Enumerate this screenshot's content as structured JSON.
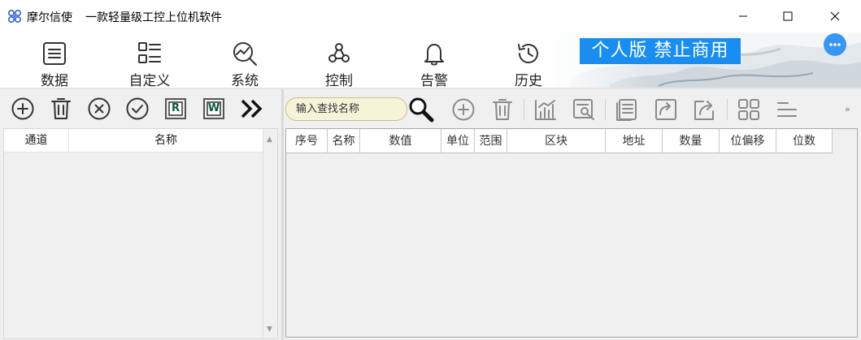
{
  "window": {
    "app_name": "摩尔信使",
    "subtitle": "一款轻量级工控上位机软件"
  },
  "ribbon": {
    "tabs": [
      {
        "label": "数据",
        "icon": "list-document-icon",
        "active": true
      },
      {
        "label": "自定义",
        "icon": "custom-list-icon",
        "active": false
      },
      {
        "label": "系统",
        "icon": "chart-search-icon",
        "active": false
      },
      {
        "label": "控制",
        "icon": "webhook-icon",
        "active": false
      },
      {
        "label": "告警",
        "icon": "bell-icon",
        "active": false
      },
      {
        "label": "历史",
        "icon": "history-clock-icon",
        "active": false
      }
    ],
    "banner": "个人版  禁止商用",
    "accent_color": "#1a8ef0"
  },
  "left_panel": {
    "toolbar": [
      {
        "name": "add-icon"
      },
      {
        "name": "delete-icon"
      },
      {
        "name": "cancel-icon"
      },
      {
        "name": "confirm-icon"
      },
      {
        "name": "read-r-icon",
        "letter": "R"
      },
      {
        "name": "write-w-icon",
        "letter": "W"
      },
      {
        "name": "double-chevron-right-icon"
      }
    ],
    "columns": [
      "通道",
      "名称"
    ]
  },
  "right_panel": {
    "search": {
      "placeholder": "输入查找名称",
      "value": ""
    },
    "columns": [
      "序号",
      "名称",
      "数值",
      "单位",
      "范围",
      "区块",
      "地址",
      "数量",
      "位偏移",
      "位数"
    ],
    "overflow_label": "»"
  }
}
